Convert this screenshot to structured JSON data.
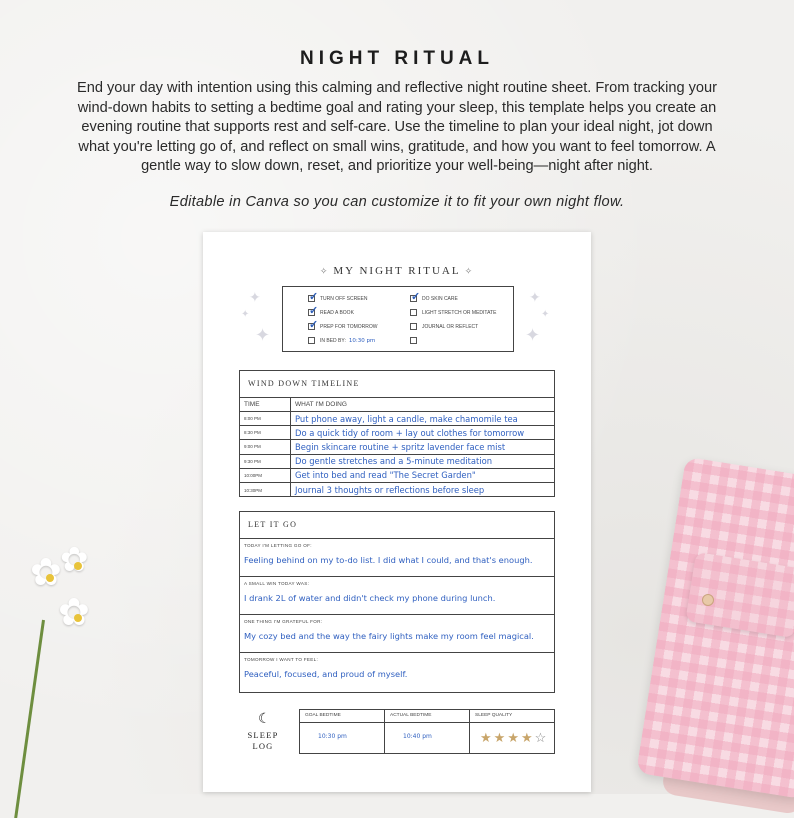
{
  "header": {
    "title": "NIGHT RITUAL",
    "description": "End your day with intention using this calming and reflective night routine sheet. From tracking your wind-down habits to setting a bedtime goal and rating your sleep, this template helps you create an evening routine that supports rest and self-care. Use the timeline to plan your ideal night, jot down what you're letting go of, and reflect on small wins, gratitude, and how you want to feel tomorrow. A gentle way to slow down, reset, and prioritize your well-being—night after night.",
    "editable_note": "Editable in Canva so you can customize it to fit your own night flow."
  },
  "sheet": {
    "title": "MY NIGHT RITUAL",
    "checklist": {
      "left": [
        {
          "label": "TURN OFF SCREEN",
          "checked": true
        },
        {
          "label": "READ A BOOK",
          "checked": true
        },
        {
          "label": "PREP FOR TOMORROW",
          "checked": true
        },
        {
          "label": "IN BED BY:",
          "checked": false,
          "value": "10:30 pm"
        }
      ],
      "right": [
        {
          "label": "DO SKIN CARE",
          "checked": true
        },
        {
          "label": "LIGHT STRETCH OR MEDITATE",
          "checked": false
        },
        {
          "label": "JOURNAL OR REFLECT",
          "checked": false
        },
        {
          "label": "",
          "checked": false
        }
      ]
    },
    "timeline": {
      "heading": "WIND DOWN TIMELINE",
      "col_time": "TIME",
      "col_what": "WHAT I'M DOING",
      "rows": [
        {
          "time": "8:00 PM",
          "what": "Put phone away, light a candle, make chamomile tea"
        },
        {
          "time": "8:30 PM",
          "what": "Do a quick tidy of room + lay out clothes for tomorrow"
        },
        {
          "time": "9:00 PM",
          "what": "Begin skincare routine + spritz lavender face mist"
        },
        {
          "time": "9:30 PM",
          "what": "Do gentle stretches and a 5-minute meditation"
        },
        {
          "time": "10:00PM",
          "what": "Get into bed and read \"The Secret Garden\""
        },
        {
          "time": "10:30PM",
          "what": "Journal 3 thoughts or reflections before sleep"
        }
      ]
    },
    "let_it_go": {
      "heading": "LET IT GO",
      "blocks": [
        {
          "label": "TODAY I'M LETTING GO OF:",
          "text": "Feeling behind on my to-do list. I did what I could, and that's enough."
        },
        {
          "label": "A SMALL WIN TODAY WAS:",
          "text": "I drank 2L of water and didn't check my phone during lunch."
        },
        {
          "label": "ONE THING I'M GRATEFUL FOR:",
          "text": "My cozy bed and the way the fairy lights make my room feel magical."
        },
        {
          "label": "TOMORROW I WANT TO FEEL:",
          "text": "Peaceful, focused, and proud of myself."
        }
      ]
    },
    "sleep_log": {
      "label_line1": "SLEEP",
      "label_line2": "LOG",
      "goal_label": "GOAL BEDTIME",
      "goal_value": "10:30 pm",
      "actual_label": "ACTUAL BEDTIME",
      "actual_value": "10:40 pm",
      "quality_label": "SLEEP QUALITY",
      "quality_rating": 4,
      "quality_max": 5
    }
  },
  "colors": {
    "ink": "#3060c0",
    "star_filled": "#c8a56a",
    "star_empty": "#888888"
  }
}
